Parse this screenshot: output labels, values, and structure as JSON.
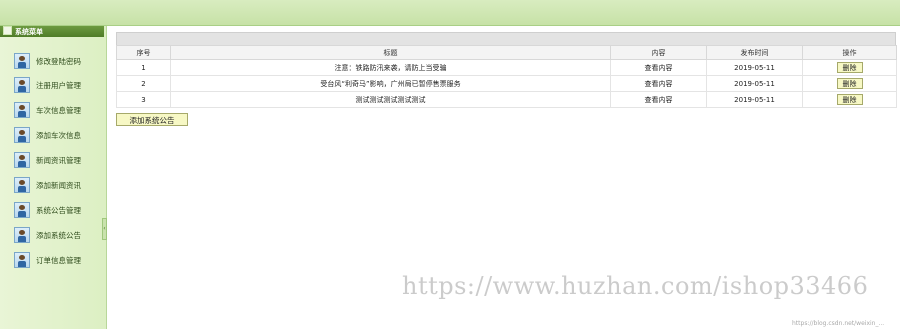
{
  "banner": {
    "title": ""
  },
  "sidebar": {
    "title": "系统菜单",
    "items": [
      {
        "label": "修改登陆密码",
        "icon": "user-icon"
      },
      {
        "label": "注册用户管理",
        "icon": "user-icon"
      },
      {
        "label": "车次信息管理",
        "icon": "user-icon"
      },
      {
        "label": "添加车次信息",
        "icon": "user-icon"
      },
      {
        "label": "新闻资讯管理",
        "icon": "user-icon"
      },
      {
        "label": "添加新闻资讯",
        "icon": "user-icon"
      },
      {
        "label": "系统公告管理",
        "icon": "user-icon"
      },
      {
        "label": "添加系统公告",
        "icon": "user-icon"
      },
      {
        "label": "订单信息管理",
        "icon": "user-icon"
      }
    ]
  },
  "table": {
    "headers": [
      "序号",
      "标题",
      "内容",
      "发布时间",
      "操作"
    ],
    "rows": [
      {
        "index": "1",
        "title": "注意：铁路防汛来袭，请防上当受骗",
        "content": "查看内容",
        "date": "2019-05-11",
        "action": "删除"
      },
      {
        "index": "2",
        "title": "受台风“利奇马”影响，广州局已暂停售票服务",
        "content": "查看内容",
        "date": "2019-05-11",
        "action": "删除"
      },
      {
        "index": "3",
        "title": "测试测试测试测试测试",
        "content": "查看内容",
        "date": "2019-05-11",
        "action": "删除"
      }
    ]
  },
  "add_button": "添加系统公告",
  "watermark": {
    "main": "https://www.huzhan.com/ishop33466",
    "small": "https://blog.csdn.net/weixin_..."
  },
  "colors": {
    "banner": "#c7e2a7",
    "sidebar": "#dcefc3",
    "sidebar_head": "#4f7c28",
    "button": "#f7f8c5"
  }
}
